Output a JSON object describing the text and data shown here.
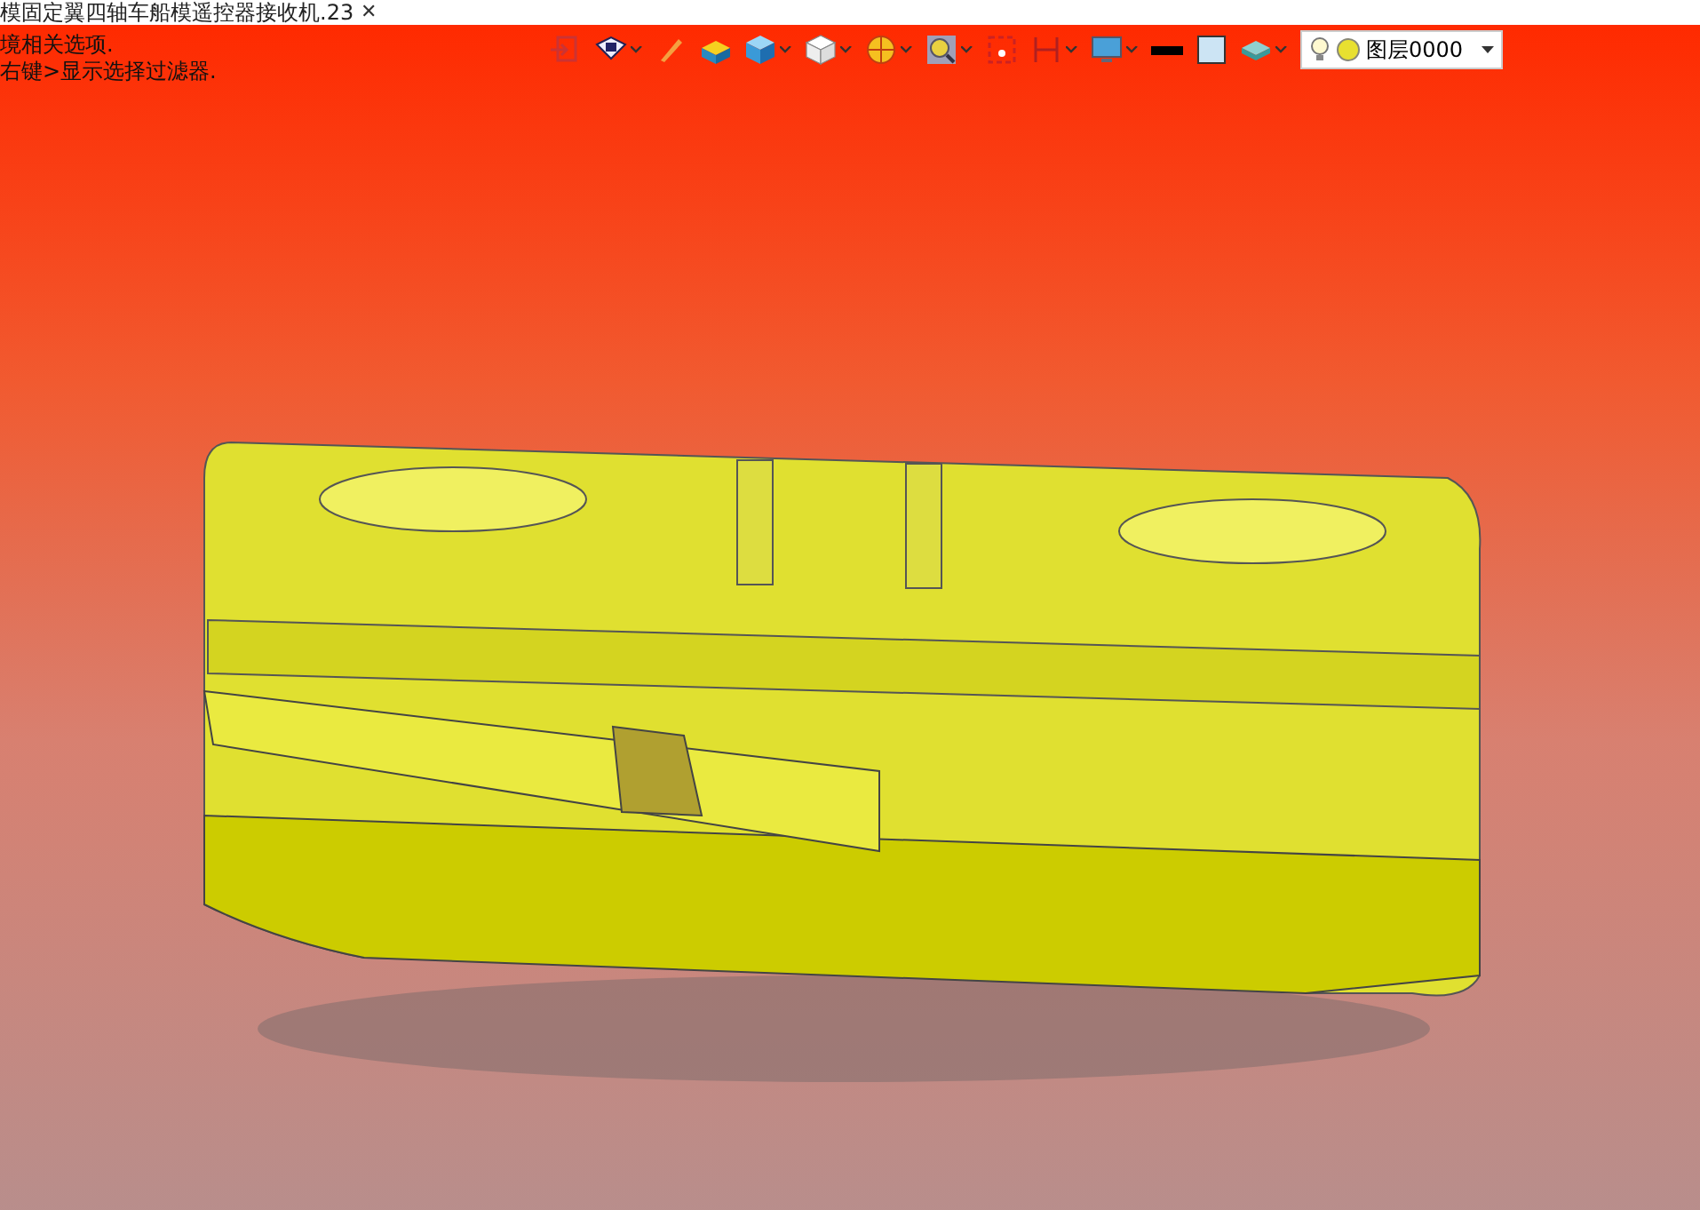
{
  "document_tab": {
    "title": "模固定翼四轴车船模遥控器接收机.23",
    "close": "✕"
  },
  "hints": [
    "境相关选项.",
    "右键>显示选择过滤器."
  ],
  "layer_box": {
    "label": "图层0000"
  }
}
